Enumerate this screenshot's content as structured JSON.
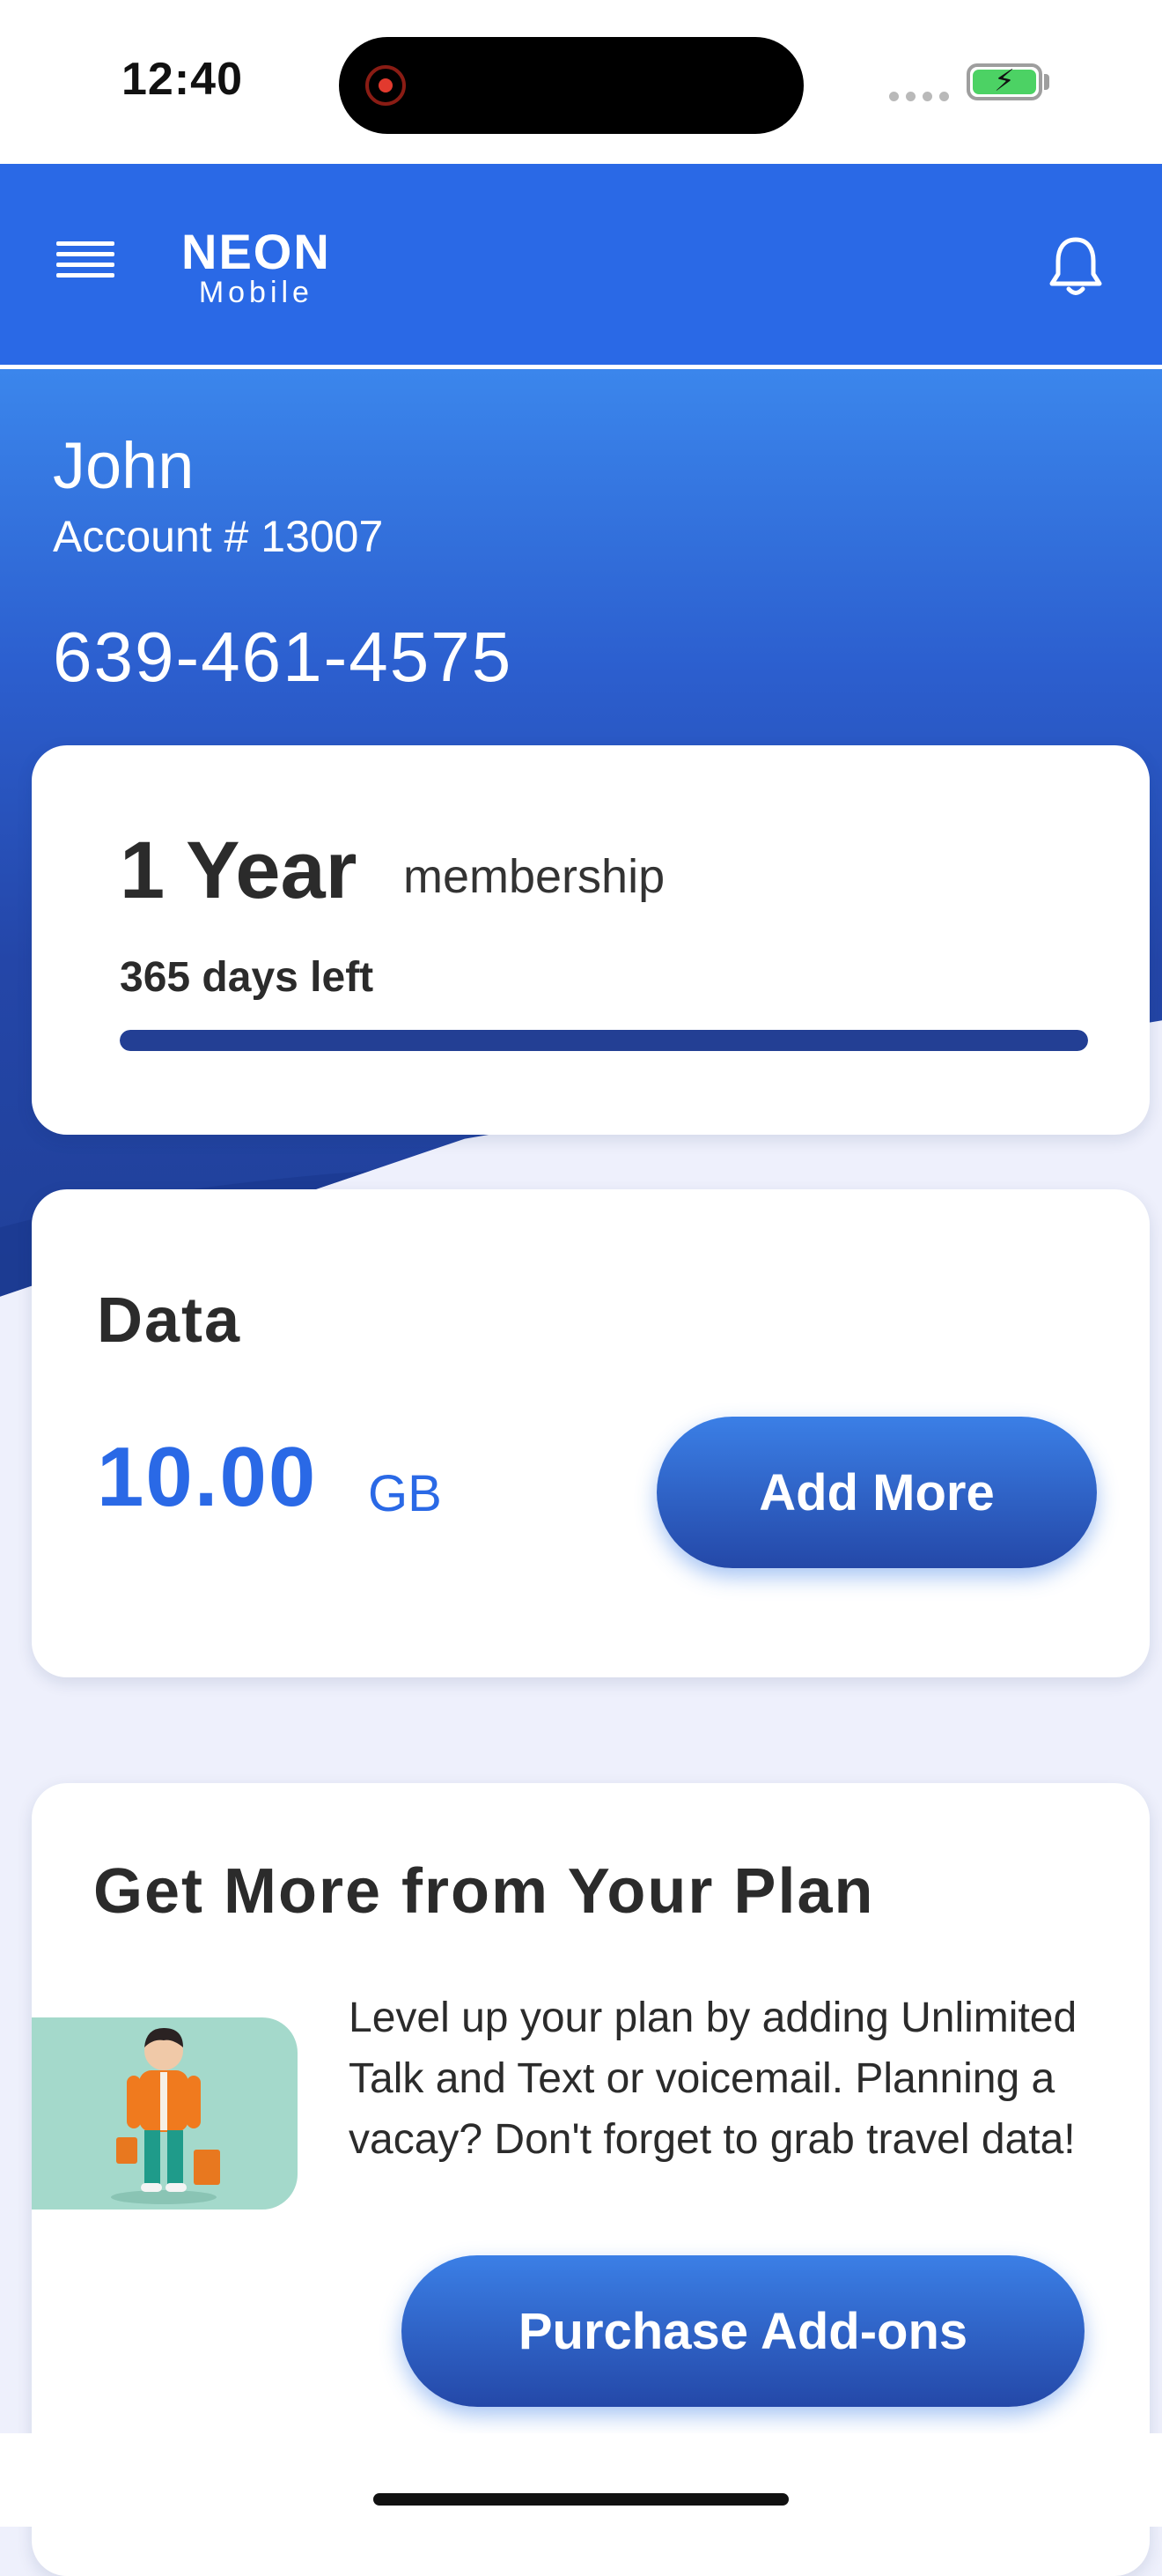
{
  "status_bar": {
    "time": "12:40"
  },
  "header": {
    "logo_top": "NEON",
    "logo_sub": "Mobile"
  },
  "account": {
    "name": "John",
    "account_number": "Account # 13007",
    "phone": "639-461-4575"
  },
  "membership": {
    "length": "1 Year",
    "suffix": "membership",
    "days_left": "365 days left",
    "progress_fraction": 1.0
  },
  "data_card": {
    "title": "Data",
    "value": "10.00",
    "unit": "GB",
    "add_more_label": "Add More"
  },
  "addons": {
    "title": "Get More from Your Plan",
    "text": "Level up your plan by adding Unlimited Talk and Text or voicemail. Planning a vacay? Don't forget to grab travel data!",
    "button_label": "Purchase Add-ons"
  },
  "colors": {
    "brand_blue": "#2a69e6",
    "dark_blue": "#233f94",
    "card_bg": "#ffffff",
    "page_bg": "#eef0fc"
  },
  "icons": [
    "menu-icon",
    "bell-icon",
    "record-icon",
    "battery-icon"
  ]
}
